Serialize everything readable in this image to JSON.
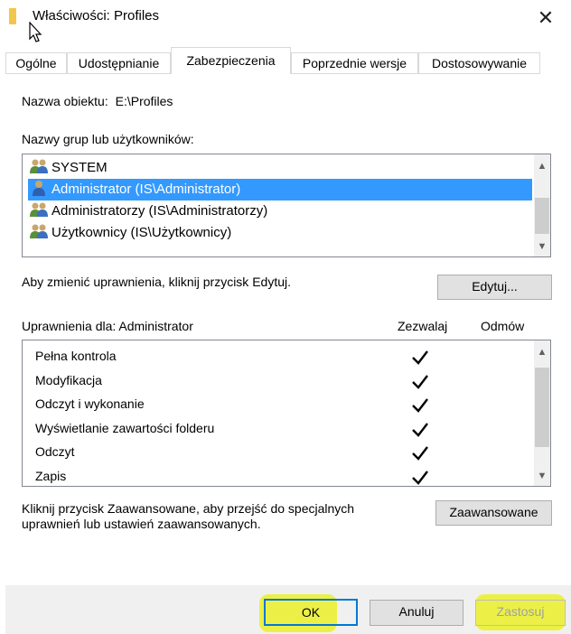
{
  "window": {
    "title": "Właściwości: Profiles",
    "close_glyph": "✕"
  },
  "tabs": [
    {
      "label": "Ogólne"
    },
    {
      "label": "Udostępnianie"
    },
    {
      "label": "Zabezpieczenia"
    },
    {
      "label": "Poprzednie wersje"
    },
    {
      "label": "Dostosowywanie"
    }
  ],
  "object_name": {
    "label": "Nazwa obiektu:",
    "value": "E:\\Profiles"
  },
  "groups": {
    "label": "Nazwy grup lub użytkowników:",
    "items": [
      {
        "label": "SYSTEM",
        "icon": "group-users-icon"
      },
      {
        "label": "Administrator (IS\\Administrator)",
        "icon": "user-icon",
        "selected": true
      },
      {
        "label": "Administratorzy (IS\\Administratorzy)",
        "icon": "group-users-icon"
      },
      {
        "label": "Użytkownicy (IS\\Użytkownicy)",
        "icon": "group-users-icon"
      }
    ]
  },
  "edit": {
    "hint": "Aby zmienić uprawnienia, kliknij przycisk Edytuj.",
    "button": "Edytuj..."
  },
  "permissions": {
    "label": "Uprawnienia dla: Administrator",
    "col_allow": "Zezwalaj",
    "col_deny": "Odmów",
    "rows": [
      {
        "name": "Pełna kontrola",
        "allow": true,
        "deny": false
      },
      {
        "name": "Modyfikacja",
        "allow": true,
        "deny": false
      },
      {
        "name": "Odczyt i wykonanie",
        "allow": true,
        "deny": false
      },
      {
        "name": "Wyświetlanie zawartości folderu",
        "allow": true,
        "deny": false
      },
      {
        "name": "Odczyt",
        "allow": true,
        "deny": false
      },
      {
        "name": "Zapis",
        "allow": true,
        "deny": false
      }
    ]
  },
  "advanced": {
    "hint_line1": "Kliknij przycisk Zaawansowane, aby przejść do specjalnych",
    "hint_line2": "uprawnień lub ustawień zaawansowanych.",
    "button": "Zaawansowane"
  },
  "footer": {
    "ok": "OK",
    "cancel": "Anuluj",
    "apply": "Zastosuj"
  },
  "colors": {
    "selection": "#3399ff",
    "default_button_border": "#0078d7",
    "highlight": "#ebf028"
  }
}
